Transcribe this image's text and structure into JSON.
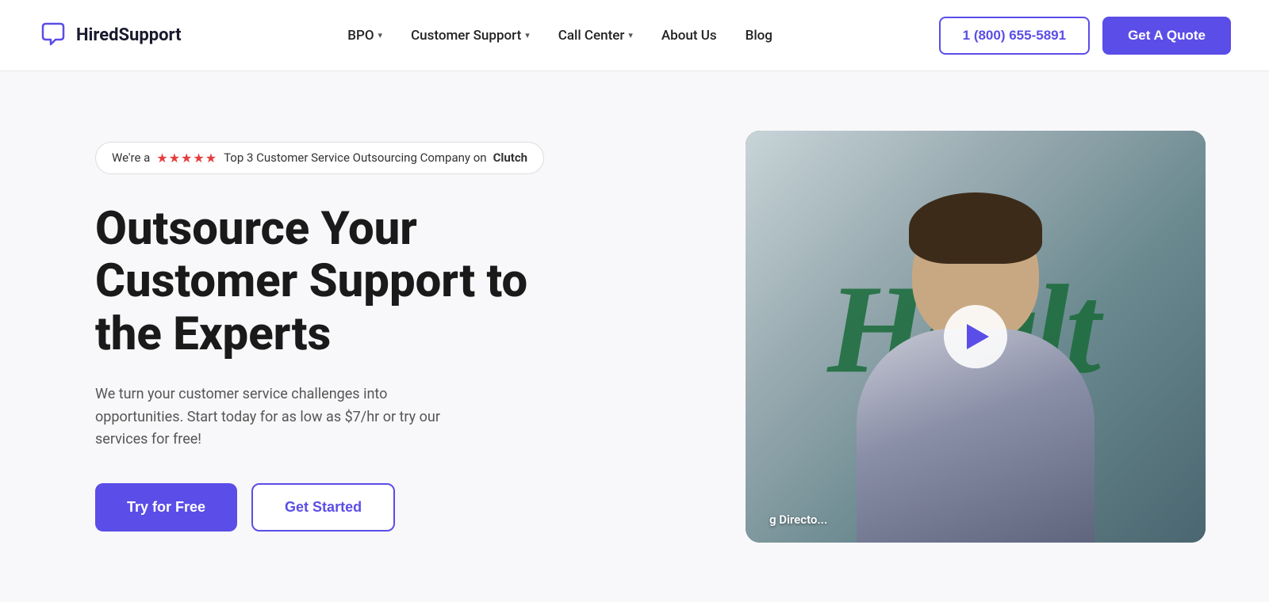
{
  "brand": {
    "name": "HiredSupport",
    "logo_icon": "💬"
  },
  "nav": {
    "items": [
      {
        "label": "BPO",
        "has_dropdown": true
      },
      {
        "label": "Customer Support",
        "has_dropdown": true
      },
      {
        "label": "Call Center",
        "has_dropdown": true
      },
      {
        "label": "About Us",
        "has_dropdown": false
      },
      {
        "label": "Blog",
        "has_dropdown": false
      }
    ],
    "phone": "1 (800) 655-5891",
    "cta": "Get A Quote"
  },
  "hero": {
    "badge_prefix": "We're a",
    "badge_stars": "★★★★★",
    "badge_suffix": "Top 3 Customer Service Outsourcing Company on",
    "badge_bold": "Clutch",
    "title_line1": "Outsource Your",
    "title_line2": "Customer Support to",
    "title_line3": "the Experts",
    "subtitle": "We turn your customer service challenges into opportunities. Start today for as low as $7/hr or try our services for free!",
    "btn_try": "Try for Free",
    "btn_started": "Get Started",
    "video_bg_text": "Healt",
    "video_caption": "g Directo..."
  }
}
